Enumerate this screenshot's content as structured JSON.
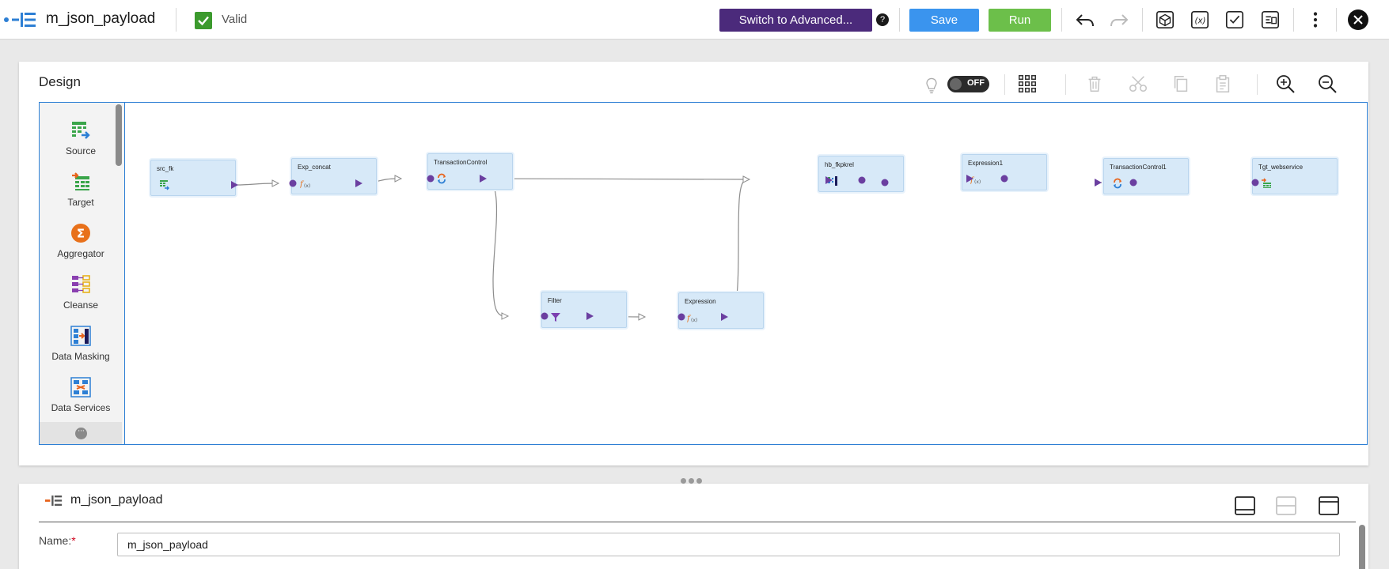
{
  "header": {
    "title": "m_json_payload",
    "status": "Valid",
    "switch_label": "Switch to Advanced...",
    "help_label": "?",
    "save_label": "Save",
    "run_label": "Run"
  },
  "design": {
    "title": "Design",
    "toggle_label": "OFF",
    "palette": [
      {
        "label": "Source"
      },
      {
        "label": "Target"
      },
      {
        "label": "Aggregator"
      },
      {
        "label": "Cleanse"
      },
      {
        "label": "Data Masking"
      },
      {
        "label": "Data Services"
      }
    ],
    "more_label": "···",
    "nodes": [
      {
        "label": "src_fk",
        "icon": "source-icon"
      },
      {
        "label": "Exp_concat",
        "icon": "expression-icon"
      },
      {
        "label": "TransactionControl",
        "icon": "transaction-icon"
      },
      {
        "label": "Filter",
        "icon": "filter-icon"
      },
      {
        "label": "Expression",
        "icon": "expression-icon"
      },
      {
        "label": "hb_fkpkrel",
        "icon": "hierarchy-builder-icon"
      },
      {
        "label": "Expression1",
        "icon": "expression-icon"
      },
      {
        "label": "TransactionControl1",
        "icon": "transaction-icon"
      },
      {
        "label": "Tgt_webservice",
        "icon": "target-icon"
      }
    ]
  },
  "properties": {
    "title": "m_json_payload",
    "name_label": "Name:",
    "name_required": "*",
    "name_value": "m_json_payload"
  },
  "colors": {
    "accent": "#2d7fd4",
    "advanced": "#4b2a7b",
    "save": "#3a94ee",
    "run": "#6cbf4a",
    "valid": "#3c9a2e",
    "node_fill": "#d7e9f8",
    "port": "#6b3fa0"
  }
}
